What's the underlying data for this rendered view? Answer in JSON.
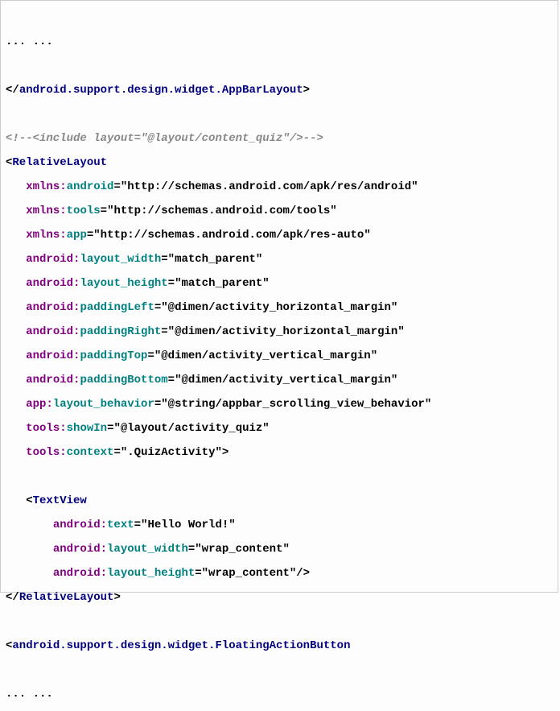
{
  "lines": {
    "l1": "... ...",
    "l2_close_tag": "android.support.design.widget.AppBarLayout",
    "l3_comment": "<!--<include layout=\"@layout/content_quiz\"/>-->",
    "rl_open": "RelativeLayout",
    "attrs": {
      "a1_ns": "xmlns:",
      "a1_name": "android",
      "a1_val": "\"http://schemas.android.com/apk/res/android\"",
      "a2_ns": "xmlns:",
      "a2_name": "tools",
      "a2_val": "\"http://schemas.android.com/tools\"",
      "a3_ns": "xmlns:",
      "a3_name": "app",
      "a3_val": "\"http://schemas.android.com/apk/res-auto\"",
      "a4_ns": "android:",
      "a4_name": "layout_width",
      "a4_val": "\"match_parent\"",
      "a5_ns": "android:",
      "a5_name": "layout_height",
      "a5_val": "\"match_parent\"",
      "a6_ns": "android:",
      "a6_name": "paddingLeft",
      "a6_val": "\"@dimen/activity_horizontal_margin\"",
      "a7_ns": "android:",
      "a7_name": "paddingRight",
      "a7_val": "\"@dimen/activity_horizontal_margin\"",
      "a8_ns": "android:",
      "a8_name": "paddingTop",
      "a8_val": "\"@dimen/activity_vertical_margin\"",
      "a9_ns": "android:",
      "a9_name": "paddingBottom",
      "a9_val": "\"@dimen/activity_vertical_margin\"",
      "a10_ns": "app:",
      "a10_name": "layout_behavior",
      "a10_val": "\"@string/appbar_scrolling_view_behavior\"",
      "a11_ns": "tools:",
      "a11_name": "showIn",
      "a11_val": "\"@layout/activity_quiz\"",
      "a12_ns": "tools:",
      "a12_name": "context",
      "a12_val": "\".QuizActivity\""
    },
    "tv_open": "TextView",
    "tv": {
      "t1_ns": "android:",
      "t1_name": "text",
      "t1_val": "\"Hello World!\"",
      "t2_ns": "android:",
      "t2_name": "layout_width",
      "t2_val": "\"wrap_content\"",
      "t3_ns": "android:",
      "t3_name": "layout_height",
      "t3_val": "\"wrap_content\""
    },
    "rl_close": "RelativeLayout",
    "fab_open": "android.support.design.widget.FloatingActionButton",
    "l_end": "... ..."
  }
}
